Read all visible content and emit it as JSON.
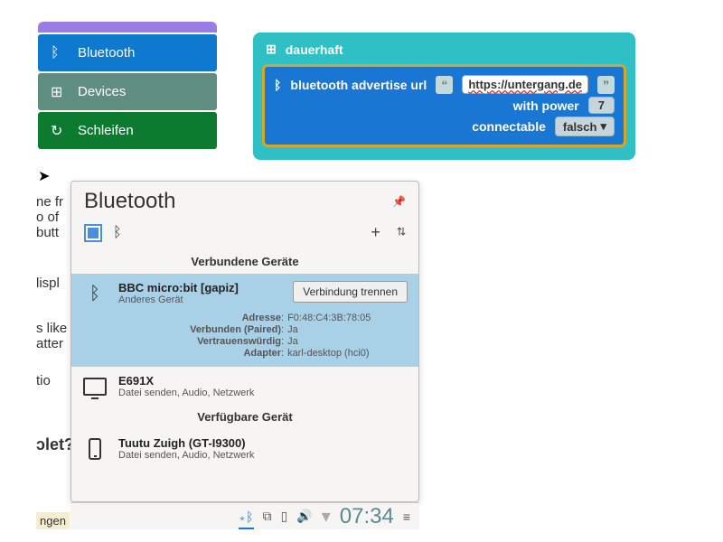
{
  "categories": {
    "bluetooth": "Bluetooth",
    "devices": "Devices",
    "loops": "Schleifen"
  },
  "block": {
    "outer_label": "dauerhaft",
    "advertise_label": "bluetooth advertise url",
    "url_value": "https://untergang.de",
    "power_label": "with power",
    "power_value": "7",
    "connectable_label": "connectable",
    "connectable_value": "falsch"
  },
  "fragments": {
    "f1": "ne fr",
    "f2": "o of",
    "f3": " butt",
    "f4": "lispl",
    "f5": "s like",
    "f6": "atter",
    "f7": " tio",
    "f8": "ɔlet?",
    "f9": "ngen"
  },
  "bt_panel": {
    "title": "Bluetooth",
    "connected_header": "Verbundene Geräte",
    "available_header": "Verfügbare Gerät",
    "disconnect_label": "Verbindung trennen",
    "microbit": {
      "name": "BBC micro:bit [gapiz]",
      "subtitle": "Anderes Gerät",
      "address_k": "Adresse",
      "address_v": "F0:48:C4:3B:78:05",
      "paired_k": "Verbunden (Paired)",
      "paired_v": "Ja",
      "trusted_k": "Vertrauenswürdig",
      "trusted_v": "Ja",
      "adapter_k": "Adapter",
      "adapter_v": "karl-desktop (hci0)"
    },
    "e691x": {
      "name": "E691X",
      "subtitle": "Datei senden, Audio, Netzwerk"
    },
    "tuutu": {
      "name": "Tuutu Zuigh (GT-I9300)",
      "subtitle": "Datei senden, Audio, Netzwerk"
    }
  },
  "taskbar": {
    "clock": "07:34"
  }
}
